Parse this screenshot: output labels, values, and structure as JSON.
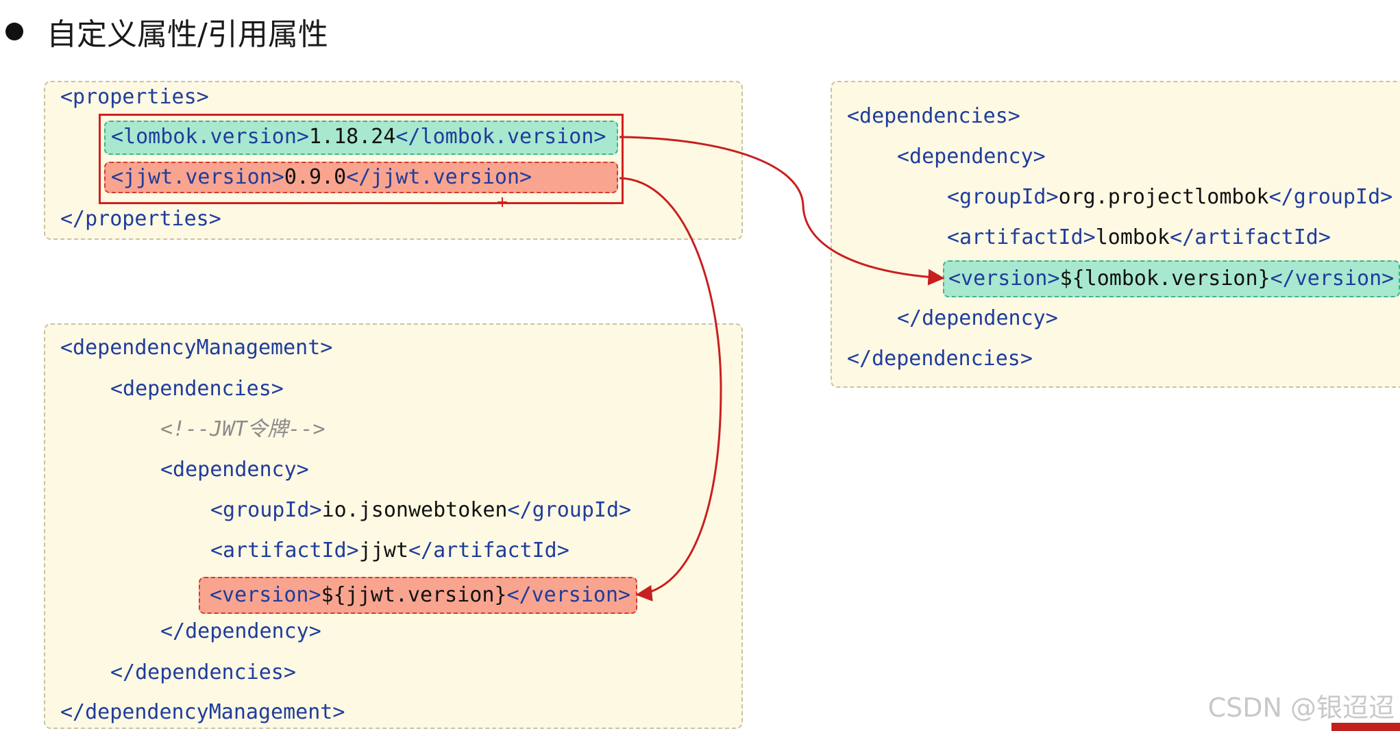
{
  "heading": "自定义属性/引用属性",
  "properties_panel": {
    "open": "<properties>",
    "lombok_prop": {
      "open": "<lombok.version>",
      "value": "1.18.24",
      "close": "</lombok.version>"
    },
    "jjwt_prop": {
      "open": "<jjwt.version>",
      "value": "0.9.0",
      "close": "</jjwt.version>"
    },
    "close": "</properties>"
  },
  "dependencies_panel": {
    "deps_open": "<dependencies>",
    "dep_open": "<dependency>",
    "group": {
      "open": "<groupId>",
      "value": "org.projectlombok",
      "close": "</groupId>"
    },
    "artifact": {
      "open": "<artifactId>",
      "value": "lombok",
      "close": "</artifactId>"
    },
    "version": {
      "open": "<version>",
      "value": "${lombok.version}",
      "close": "</version>"
    },
    "dep_close": "</dependency>",
    "deps_close": "</dependencies>"
  },
  "management_panel": {
    "mgmt_open": "<dependencyManagement>",
    "deps_open": "<dependencies>",
    "comment": "<!--JWT令牌-->",
    "dep_open": "<dependency>",
    "group": {
      "open": "<groupId>",
      "value": "io.jsonwebtoken",
      "close": "</groupId>"
    },
    "artifact": {
      "open": "<artifactId>",
      "value": "jjwt",
      "close": "</artifactId>"
    },
    "version": {
      "open": "<version>",
      "value": "${jjwt.version}",
      "close": "</version>"
    },
    "dep_close": "</dependency>",
    "deps_close": "</dependencies>",
    "mgmt_close": "</dependencyManagement>"
  },
  "watermark": "CSDN @银迢迢",
  "colors": {
    "panel_bg": "#fdf9e3",
    "green_highlight": "#a8e8cf",
    "red_highlight": "#f8a48f",
    "arrow": "#c81f1f",
    "tag": "#1f3c9c"
  }
}
